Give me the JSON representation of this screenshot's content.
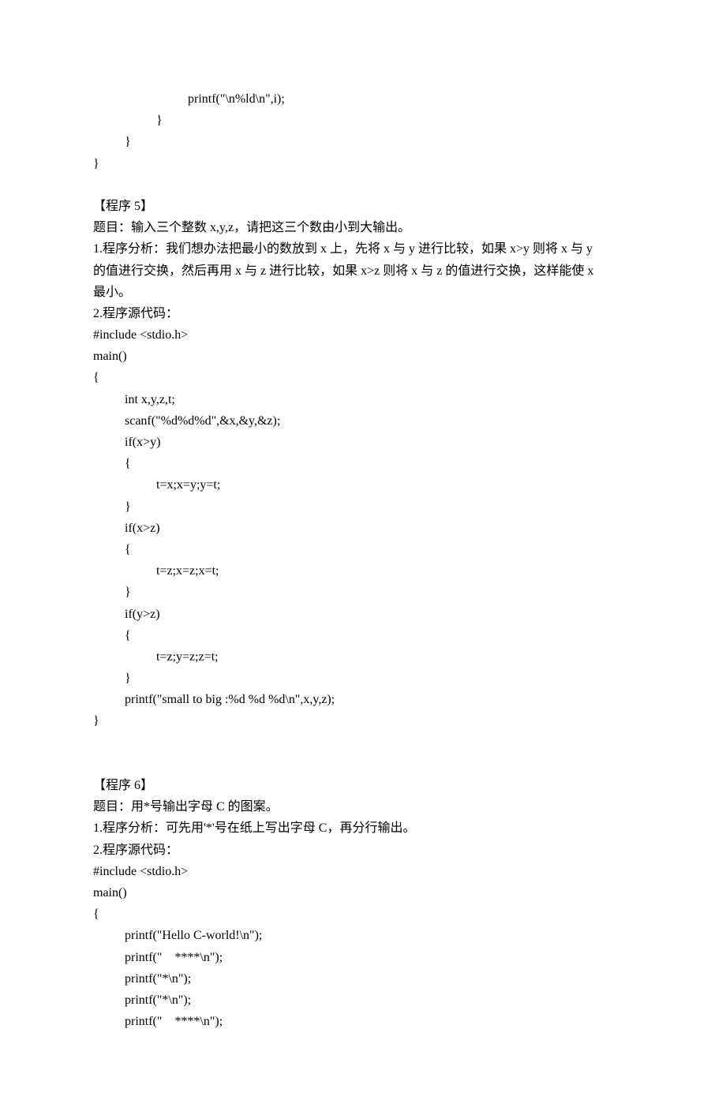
{
  "block0": {
    "l1": "printf(\"\\n%ld\\n\",i);",
    "l2": "}",
    "l3": "}",
    "l4": "}"
  },
  "prog5": {
    "title": "【程序 5】",
    "topic": "题目：输入三个整数 x,y,z，请把这三个数由小到大输出。",
    "analysis1": "1.程序分析：我们想办法把最小的数放到 x 上，先将 x 与 y 进行比较，如果 x>y 则将 x 与 y",
    "analysis2": "的值进行交换，然后再用 x 与 z 进行比较，如果 x>z 则将 x 与 z 的值进行交换，这样能使 x",
    "analysis3": "最小。",
    "srclabel": "2.程序源代码：",
    "c1": "#include <stdio.h>",
    "c2": "main()",
    "c3": "{",
    "c4": "int x,y,z,t;",
    "c5": "scanf(\"%d%d%d\",&x,&y,&z);",
    "c6": "if(x>y)",
    "c7": "{",
    "c8": "t=x;x=y;y=t;",
    "c9": "}",
    "c10": "if(x>z)",
    "c11": "{",
    "c12": "t=z;x=z;x=t;",
    "c13": "}",
    "c14": "if(y>z)",
    "c15": "{",
    "c16": "t=z;y=z;z=t;",
    "c17": "}",
    "c18": "printf(\"small to big :%d %d %d\\n\",x,y,z);",
    "c19": "}"
  },
  "prog6": {
    "title": "【程序 6】",
    "topic": "题目：用*号输出字母 C 的图案。",
    "analysis": "1.程序分析：可先用'*'号在纸上写出字母 C，再分行输出。",
    "srclabel": "2.程序源代码：",
    "c1": "#include <stdio.h>",
    "c2": "main()",
    "c3": "{",
    "c4": "printf(\"Hello C-world!\\n\");",
    "c5": "printf(\"    ****\\n\");",
    "c6": "printf(\"*\\n\");",
    "c7": "printf(\"*\\n\");",
    "c8": "printf(\"    ****\\n\");"
  }
}
